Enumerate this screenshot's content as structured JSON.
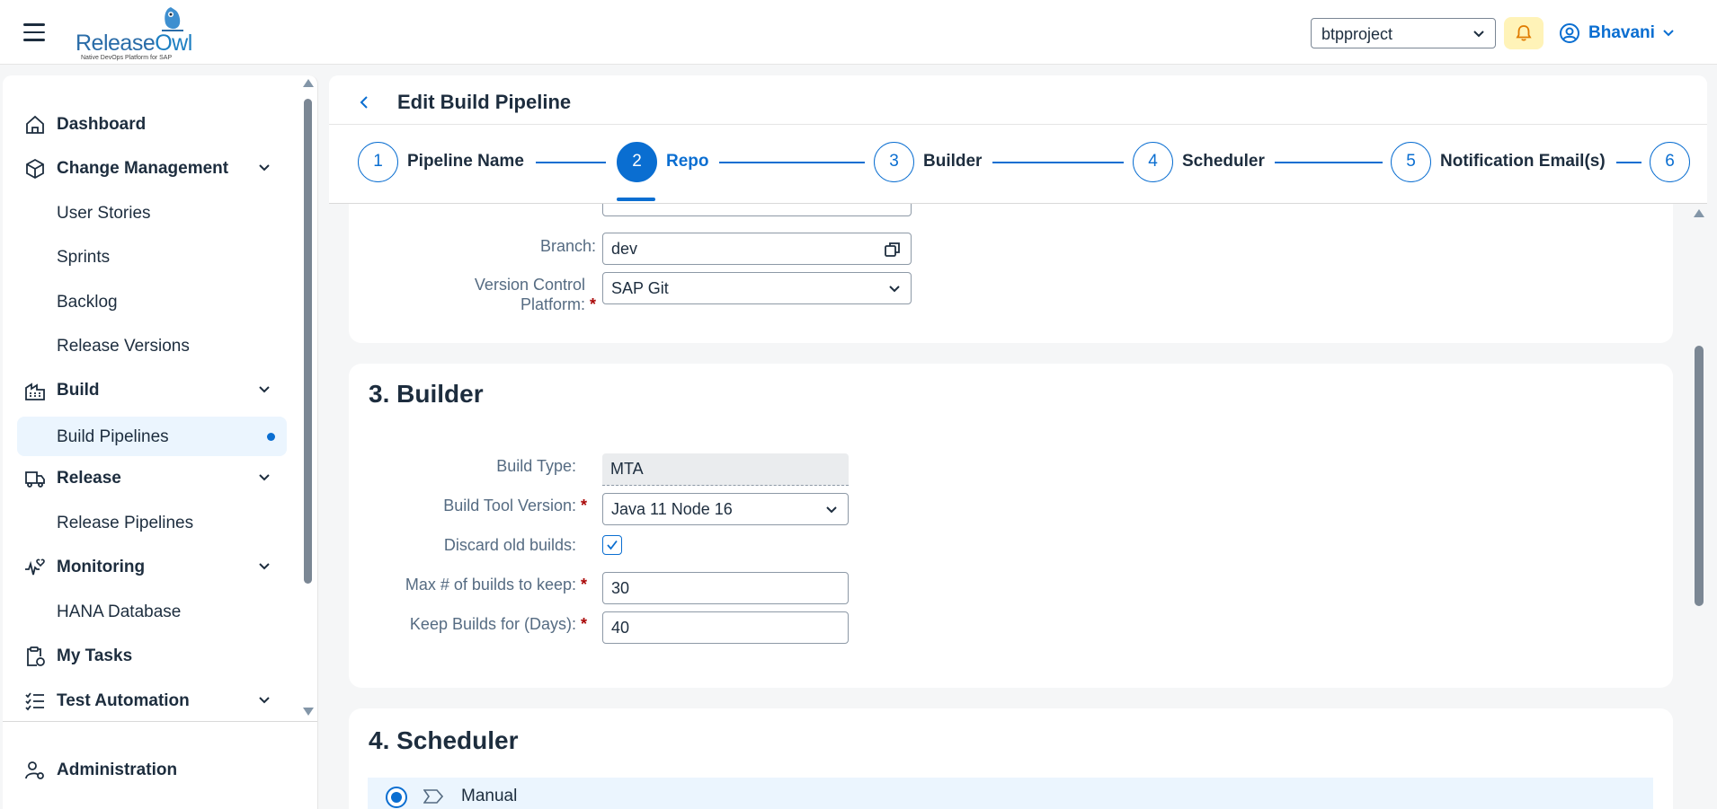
{
  "app": {
    "logo_text_a": "Release",
    "logo_text_b": "Owl",
    "logo_tagline": "Native DevOps Platform for SAP",
    "project_selected": "btpproject",
    "user_name": "Bhavani"
  },
  "sidebar": {
    "items": [
      {
        "label": "Dashboard",
        "icon": "home-icon",
        "type": "top"
      },
      {
        "label": "Change Management",
        "icon": "box-icon",
        "type": "top",
        "expandable": true
      },
      {
        "label": "User Stories",
        "type": "sub"
      },
      {
        "label": "Sprints",
        "type": "sub"
      },
      {
        "label": "Backlog",
        "type": "sub"
      },
      {
        "label": "Release Versions",
        "type": "sub"
      },
      {
        "label": "Build",
        "icon": "factory-icon",
        "type": "top",
        "expandable": true
      },
      {
        "label": "Build Pipelines",
        "type": "sub",
        "active": true
      },
      {
        "label": "Release",
        "icon": "truck-icon",
        "type": "top",
        "expandable": true
      },
      {
        "label": "Release Pipelines",
        "type": "sub"
      },
      {
        "label": "Monitoring",
        "icon": "heartbeat-icon",
        "type": "top",
        "expandable": true
      },
      {
        "label": "HANA Database",
        "type": "sub"
      },
      {
        "label": "My Tasks",
        "icon": "clipboard-icon",
        "type": "top"
      },
      {
        "label": "Test Automation",
        "icon": "checklist-icon",
        "type": "top",
        "expandable": true
      }
    ],
    "footer_item": {
      "label": "Administration",
      "icon": "user-settings-icon"
    }
  },
  "page": {
    "title": "Edit Build Pipeline"
  },
  "wizard": {
    "steps": [
      {
        "number": "1",
        "label": "Pipeline Name"
      },
      {
        "number": "2",
        "label": "Repo",
        "current": true
      },
      {
        "number": "3",
        "label": "Builder"
      },
      {
        "number": "4",
        "label": "Scheduler"
      },
      {
        "number": "5",
        "label": "Notification Email(s)"
      },
      {
        "number": "6",
        "label": ""
      }
    ]
  },
  "repo_section": {
    "branch_label": "Branch:",
    "branch_value": "dev",
    "vcp_label_line1": "Version Control",
    "vcp_label_line2": "Platform:",
    "vcp_value": "SAP Git"
  },
  "builder_section": {
    "title": "3. Builder",
    "build_type_label": "Build Type:",
    "build_type_value": "MTA",
    "build_tool_label": "Build Tool Version:",
    "build_tool_value": "Java 11 Node 16",
    "discard_label": "Discard old builds:",
    "discard_checked": true,
    "max_builds_label": "Max # of builds to keep:",
    "max_builds_value": "30",
    "keep_days_label": "Keep Builds for (Days):",
    "keep_days_value": "40"
  },
  "scheduler_section": {
    "title": "4. Scheduler",
    "option_manual": "Manual"
  },
  "colors": {
    "accent": "#0a6ed1",
    "required": "#aa0808",
    "bell_bg": "#fff3b8",
    "active_nav_bg": "#ebf5fe"
  }
}
